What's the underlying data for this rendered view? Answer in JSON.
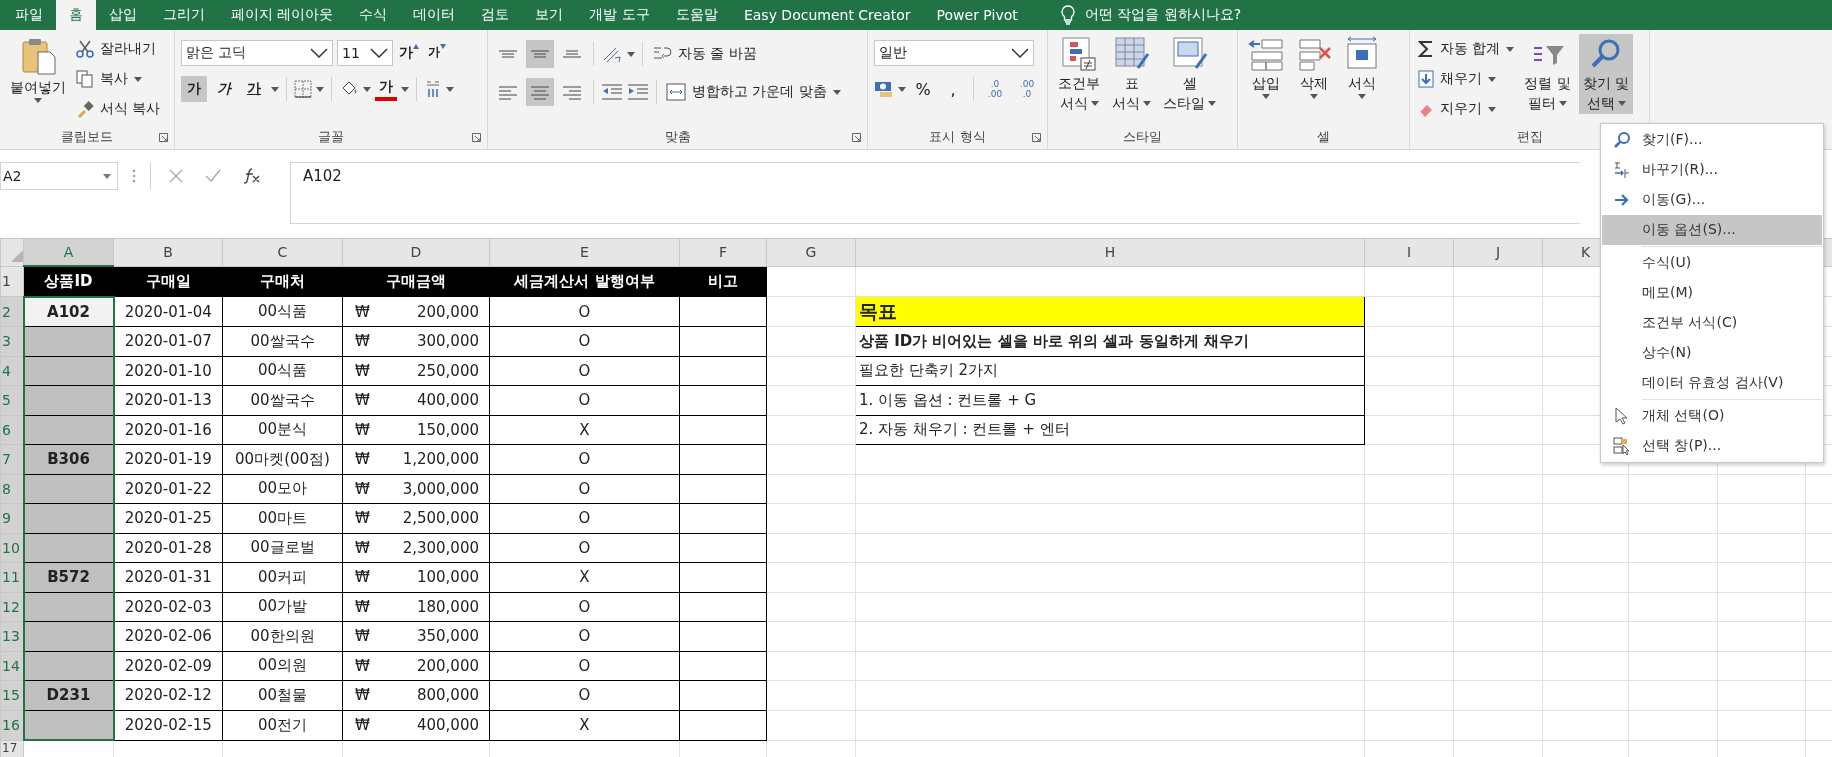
{
  "tabs": [
    {
      "label": "파일",
      "selected": false
    },
    {
      "label": "홈",
      "selected": true
    },
    {
      "label": "삽입",
      "selected": false
    },
    {
      "label": "그리기",
      "selected": false
    },
    {
      "label": "페이지 레이아웃",
      "selected": false
    },
    {
      "label": "수식",
      "selected": false
    },
    {
      "label": "데이터",
      "selected": false
    },
    {
      "label": "검토",
      "selected": false
    },
    {
      "label": "보기",
      "selected": false
    },
    {
      "label": "개발 도구",
      "selected": false
    },
    {
      "label": "도움말",
      "selected": false
    },
    {
      "label": "Easy Document Creator",
      "selected": false
    },
    {
      "label": "Power Pivot",
      "selected": false
    }
  ],
  "tell_me": "어떤 작업을 원하시나요?",
  "clipboard": {
    "label": "클립보드",
    "paste": "붙여넣기",
    "commands": [
      {
        "kind": "cut",
        "label": "잘라내기",
        "dropdown": false
      },
      {
        "kind": "copy",
        "label": "복사",
        "dropdown": true
      },
      {
        "kind": "format",
        "label": "서식 복사",
        "dropdown": false
      }
    ]
  },
  "font": {
    "label": "글꼴",
    "name": "맑은 고딕",
    "size": "11",
    "grow": "가",
    "shrink": "가",
    "styles": [
      {
        "kind": "bold",
        "label": "가",
        "selected": true
      },
      {
        "kind": "italic",
        "label": "가",
        "selected": false
      },
      {
        "kind": "underline",
        "label": "가",
        "selected": false
      }
    ],
    "font_color": "가"
  },
  "alignment": {
    "label": "맞춤",
    "vertical": [
      {
        "kind": "top",
        "selected": false
      },
      {
        "kind": "middle",
        "selected": true
      },
      {
        "kind": "bottom",
        "selected": false
      }
    ],
    "horizontal": [
      {
        "kind": "left",
        "selected": false
      },
      {
        "kind": "center",
        "selected": true
      },
      {
        "kind": "right",
        "selected": false
      }
    ],
    "wrap": "자동 줄 바꿈",
    "merge": "병합하고 가운데 맞춤"
  },
  "number": {
    "label": "표시 형식",
    "format": "일반",
    "percent": "%",
    "comma": ",",
    "increase_decimal": [
      ".0",
      ".00"
    ],
    "decrease_decimal": [
      ".00",
      ".0"
    ]
  },
  "styles": {
    "label": "스타일",
    "buttons": [
      {
        "kind": "conditional",
        "lines": [
          "조건부",
          "서식"
        ]
      },
      {
        "kind": "table",
        "lines": [
          "표",
          "서식"
        ]
      },
      {
        "kind": "cell",
        "lines": [
          "셀",
          "스타일"
        ]
      }
    ]
  },
  "cells": {
    "label": "셀",
    "buttons": [
      {
        "kind": "insert",
        "label": "삽입"
      },
      {
        "kind": "delete",
        "label": "삭제"
      },
      {
        "kind": "format",
        "label": "서식"
      }
    ]
  },
  "editing": {
    "label": "편집",
    "commands": [
      {
        "kind": "autosum",
        "label": "자동 합계"
      },
      {
        "kind": "fill",
        "label": "채우기"
      },
      {
        "kind": "clear",
        "label": "지우기"
      }
    ],
    "buttons": [
      {
        "kind": "sort",
        "lines": [
          "정렬 및",
          "필터"
        ],
        "selected": false
      },
      {
        "kind": "find",
        "lines": [
          "찾기 및",
          "선택"
        ],
        "selected": true
      }
    ]
  },
  "formula_bar": {
    "name_box": "A2",
    "formula": "A102"
  },
  "columns": [
    {
      "letter": "A",
      "selected": true
    },
    {
      "letter": "B",
      "selected": false
    },
    {
      "letter": "C",
      "selected": false
    },
    {
      "letter": "D",
      "selected": false
    },
    {
      "letter": "E",
      "selected": false
    },
    {
      "letter": "F",
      "selected": false
    },
    {
      "letter": "G",
      "selected": false
    },
    {
      "letter": "H",
      "selected": false
    },
    {
      "letter": "I",
      "selected": false
    },
    {
      "letter": "J",
      "selected": false
    },
    {
      "letter": "K",
      "selected": false
    }
  ],
  "header_row": {
    "num": "1",
    "cells": [
      "상품ID",
      "구매일",
      "구매처",
      "구매금액",
      "세금계산서 발행여부",
      "비고"
    ]
  },
  "rows": [
    {
      "num": "2",
      "selected": true,
      "active": true,
      "id": "A102",
      "date": "2020-01-04",
      "vendor": "00식품",
      "currency": "₩",
      "amount": "200,000",
      "tax": "O"
    },
    {
      "num": "3",
      "selected": true,
      "active": false,
      "date": "2020-01-07",
      "vendor": "00쌀국수",
      "currency": "₩",
      "amount": "300,000",
      "tax": "O"
    },
    {
      "num": "4",
      "selected": true,
      "active": false,
      "date": "2020-01-10",
      "vendor": "00식품",
      "currency": "₩",
      "amount": "250,000",
      "tax": "O"
    },
    {
      "num": "5",
      "selected": true,
      "active": false,
      "date": "2020-01-13",
      "vendor": "00쌀국수",
      "currency": "₩",
      "amount": "400,000",
      "tax": "O"
    },
    {
      "num": "6",
      "selected": true,
      "active": false,
      "date": "2020-01-16",
      "vendor": "00분식",
      "currency": "₩",
      "amount": "150,000",
      "tax": "X"
    },
    {
      "num": "7",
      "selected": true,
      "active": false,
      "id": "B306",
      "date": "2020-01-19",
      "vendor": "00마켓(00점)",
      "currency": "₩",
      "amount": "1,200,000",
      "tax": "O"
    },
    {
      "num": "8",
      "selected": true,
      "active": false,
      "date": "2020-01-22",
      "vendor": "00모아",
      "currency": "₩",
      "amount": "3,000,000",
      "tax": "O"
    },
    {
      "num": "9",
      "selected": true,
      "active": false,
      "date": "2020-01-25",
      "vendor": "00마트",
      "currency": "₩",
      "amount": "2,500,000",
      "tax": "O"
    },
    {
      "num": "10",
      "selected": true,
      "active": false,
      "date": "2020-01-28",
      "vendor": "00글로벌",
      "currency": "₩",
      "amount": "2,300,000",
      "tax": "O"
    },
    {
      "num": "11",
      "selected": true,
      "active": false,
      "id": "B572",
      "date": "2020-01-31",
      "vendor": "00커피",
      "currency": "₩",
      "amount": "100,000",
      "tax": "X"
    },
    {
      "num": "12",
      "selected": true,
      "active": false,
      "date": "2020-02-03",
      "vendor": "00가발",
      "currency": "₩",
      "amount": "180,000",
      "tax": "O"
    },
    {
      "num": "13",
      "selected": true,
      "active": false,
      "date": "2020-02-06",
      "vendor": "00한의원",
      "currency": "₩",
      "amount": "350,000",
      "tax": "O"
    },
    {
      "num": "14",
      "selected": true,
      "active": false,
      "date": "2020-02-09",
      "vendor": "00의원",
      "currency": "₩",
      "amount": "200,000",
      "tax": "O"
    },
    {
      "num": "15",
      "selected": true,
      "active": false,
      "id": "D231",
      "date": "2020-02-12",
      "vendor": "00철물",
      "currency": "₩",
      "amount": "800,000",
      "tax": "O"
    },
    {
      "num": "16",
      "selected": true,
      "active": false,
      "date": "2020-02-15",
      "vendor": "00전기",
      "currency": "₩",
      "amount": "400,000",
      "tax": "X"
    }
  ],
  "last_row": {
    "num": "17"
  },
  "goal": {
    "title": "목표",
    "summary": "상품 ID가 비어있는 셀을 바로 위의 셀과 동일하게 채우기",
    "lines": [
      "필요한 단축키 2가지",
      "1. 이동 옵션 : 컨트롤 + G",
      "2. 자동 채우기 : 컨트롤 + 엔터"
    ]
  },
  "menu": {
    "groups": [
      [
        {
          "kind": "find",
          "label": "찾기(F)...",
          "selected": false
        },
        {
          "kind": "replace",
          "label": "바꾸기(R)...",
          "selected": false
        },
        {
          "kind": "goto",
          "label": "이동(G)...",
          "selected": false
        },
        {
          "kind": "plain",
          "label": "이동 옵션(S)...",
          "selected": true
        }
      ],
      [
        {
          "kind": "plain",
          "label": "수식(U)",
          "selected": false
        },
        {
          "kind": "plain",
          "label": "메모(M)",
          "selected": false
        },
        {
          "kind": "plain",
          "label": "조건부 서식(C)",
          "selected": false
        },
        {
          "kind": "plain",
          "label": "상수(N)",
          "selected": false
        },
        {
          "kind": "plain",
          "label": "데이터 유효성 검사(V)",
          "selected": false
        }
      ],
      [
        {
          "kind": "pointer",
          "label": "개체 선택(O)",
          "selected": false
        },
        {
          "kind": "pane",
          "label": "선택 창(P)...",
          "selected": false
        }
      ]
    ]
  }
}
